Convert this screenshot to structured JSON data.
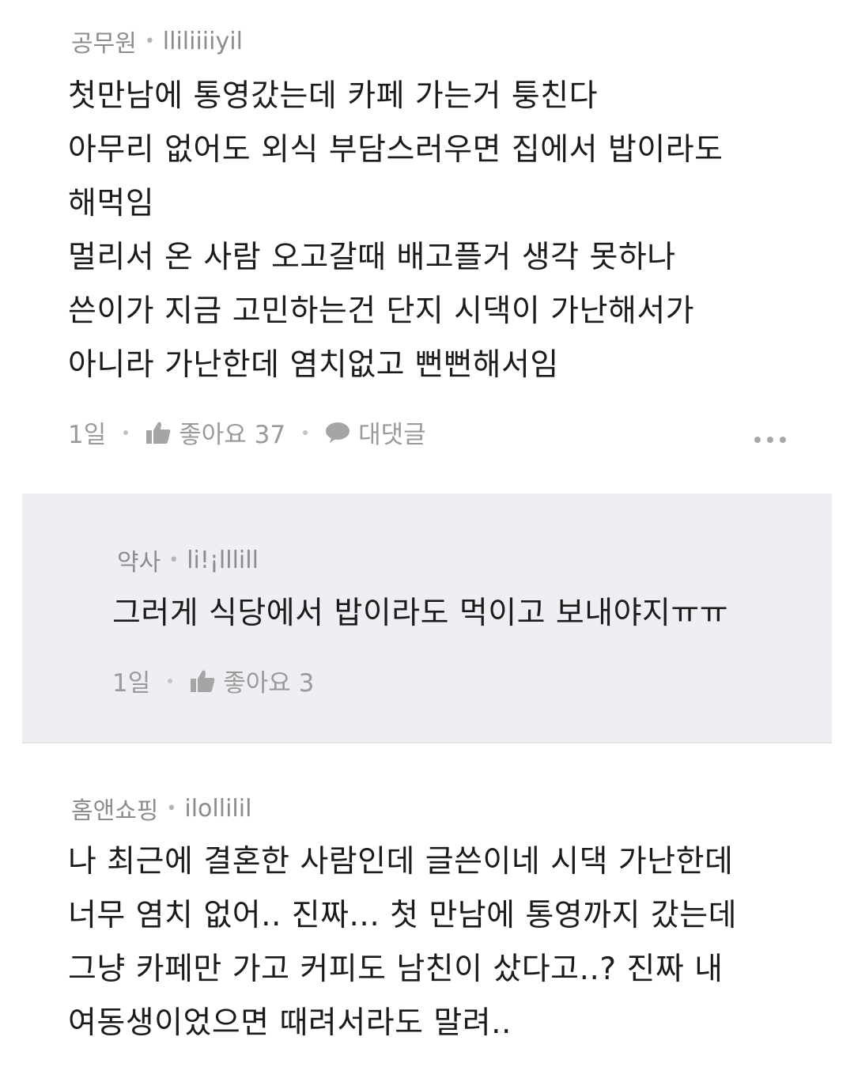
{
  "comments": [
    {
      "nickname": "공무원",
      "user_id": "lliliiiiyil",
      "lines": [
        "첫만남에 통영갔는데 카페 가는거 퉁친다",
        "아무리 없어도 외식 부담스러우면 집에서 밥이라도",
        "해먹임",
        "멀리서 온 사람 오고갈때 배고플거 생각 못하나",
        "쓴이가 지금 고민하는건 단지 시댁이 가난해서가",
        "아니라 가난한데 염치없고 뻔뻔해서임"
      ],
      "time": "1일",
      "like_label": "좋아요 37",
      "reply_label": "대댓글"
    }
  ],
  "reply": {
    "nickname": "약사",
    "user_id": "li!¡lllill",
    "text": "그러게 식당에서 밥이라도 먹이고 보내야지ㅠㅠ",
    "time": "1일",
    "like_label": "좋아요 3"
  },
  "comment2": {
    "nickname": "홈앤쇼핑",
    "user_id": "ilollilil",
    "lines": [
      "나 최근에 결혼한 사람인데 글쓴이네 시댁 가난한데",
      "너무 염치 없어.. 진짜... 첫 만남에 통영까지 갔는데",
      "그냥 카페만 가고 커피도 남친이 샀다고..? 진짜 내",
      "여동생이었으면 때려서라도 말려.."
    ]
  }
}
